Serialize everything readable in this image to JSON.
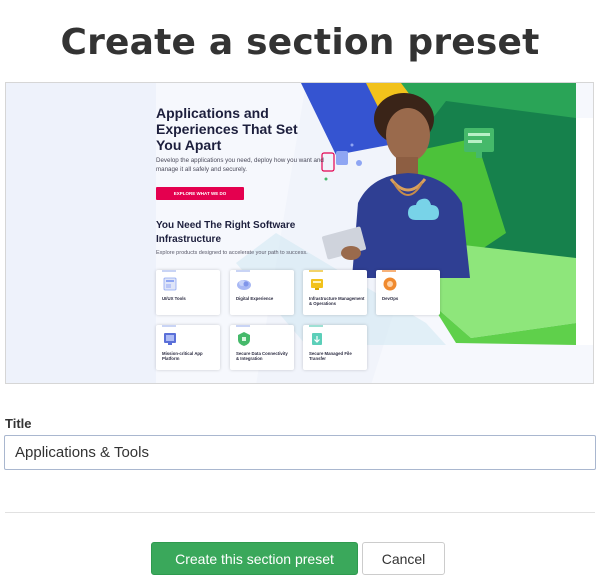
{
  "page": {
    "title": "Create a section preset"
  },
  "preview": {
    "hero_heading": "Applications and Experiences That Set You Apart",
    "hero_description": "Develop the applications you need, deploy how you want and manage it all safely and securely.",
    "cta_label": "EXPLORE WHAT WE DO",
    "section_heading": "You Need The Right Software Infrastructure",
    "section_description": "Explore products designed to accelerate your path to success.",
    "tiles": [
      {
        "label": "UI/UX Tools"
      },
      {
        "label": "Digital Experience"
      },
      {
        "label": "Infrastructure Management & Operations"
      },
      {
        "label": "DevOps"
      },
      {
        "label": "Mission-critical App Platform"
      },
      {
        "label": "Secure Data Connectivity & Integration"
      },
      {
        "label": "Secure Managed File Transfer"
      }
    ],
    "colors": {
      "green_light": "#8ee67b",
      "green_mid": "#4cc23a",
      "green_dark": "#16814c",
      "blue": "#3554d1",
      "accent": "#e4004f"
    }
  },
  "form": {
    "title_label": "Title",
    "title_value": "Applications & Tools",
    "submit_label": "Create this section preset",
    "cancel_label": "Cancel"
  }
}
